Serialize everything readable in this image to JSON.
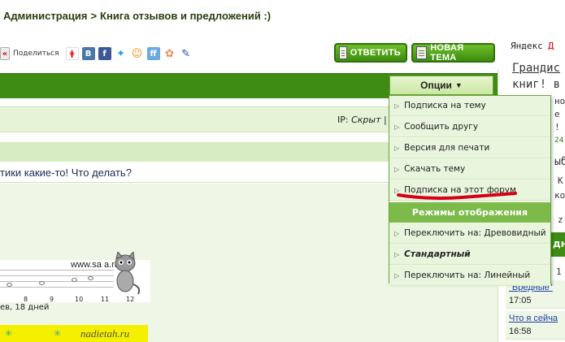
{
  "breadcrumb": {
    "parent": "Администрация",
    "separator": ">",
    "current": "Книга отзывов и предложений :)"
  },
  "share": {
    "label": "Поделиться",
    "icons": [
      "back-icon",
      "ya-share-icon",
      "vkontakte-icon",
      "facebook-icon",
      "twitter-icon",
      "odnoklassniki-icon",
      "friendfeed-icon",
      "moimir-icon",
      "livejournal-icon"
    ]
  },
  "actions": {
    "reply": "ОТВЕТИТЬ",
    "new_topic": "НОВАЯ ТЕМА"
  },
  "options": {
    "label": "Опции",
    "items": [
      "Подписка на тему",
      "Сообщить другу",
      "Версия для печати",
      "Скачать тему",
      "Подписка на этот форум"
    ],
    "modes_header": "Режимы отображения",
    "modes": [
      "Переключить на: Древовидный",
      "Стандартный",
      "Переключить на: Линейный"
    ]
  },
  "post": {
    "ip_label": "IP:",
    "ip_value": "Скрыт",
    "ip_sep": "|",
    "subject": "тики какие-то! Что делать?"
  },
  "ticker": {
    "url": "www.sa        a.ru",
    "numbers": [
      "8",
      "9",
      "10",
      "11",
      "12"
    ],
    "caption": "ев, 18 дней"
  },
  "banner": {
    "text": "nadietah.ru"
  },
  "right": {
    "yandex_prefix": "Яндекс",
    "yandex_red": "Д",
    "head1": "Грандис",
    "head2": "книг! в",
    "frag_a": "но",
    "frag_b": "е",
    "frag_c": "!",
    "frag_d": "24",
    "frag_e": "ыб",
    "frag_f": "К",
    "frag_g": "ко",
    "frag_h": "z",
    "frag_i": "1",
    "bar_label": "дн",
    "links": [
      {
        "title": "\"Вредные\"",
        "time": "17:05"
      },
      {
        "title": "Что я сейча",
        "time": "16:58"
      }
    ]
  },
  "colors": {
    "forum_green": "#3f8c15",
    "light_green": "#e6f3d7",
    "button_green": "#4f9f1c",
    "underline_red": "#d4001a"
  }
}
